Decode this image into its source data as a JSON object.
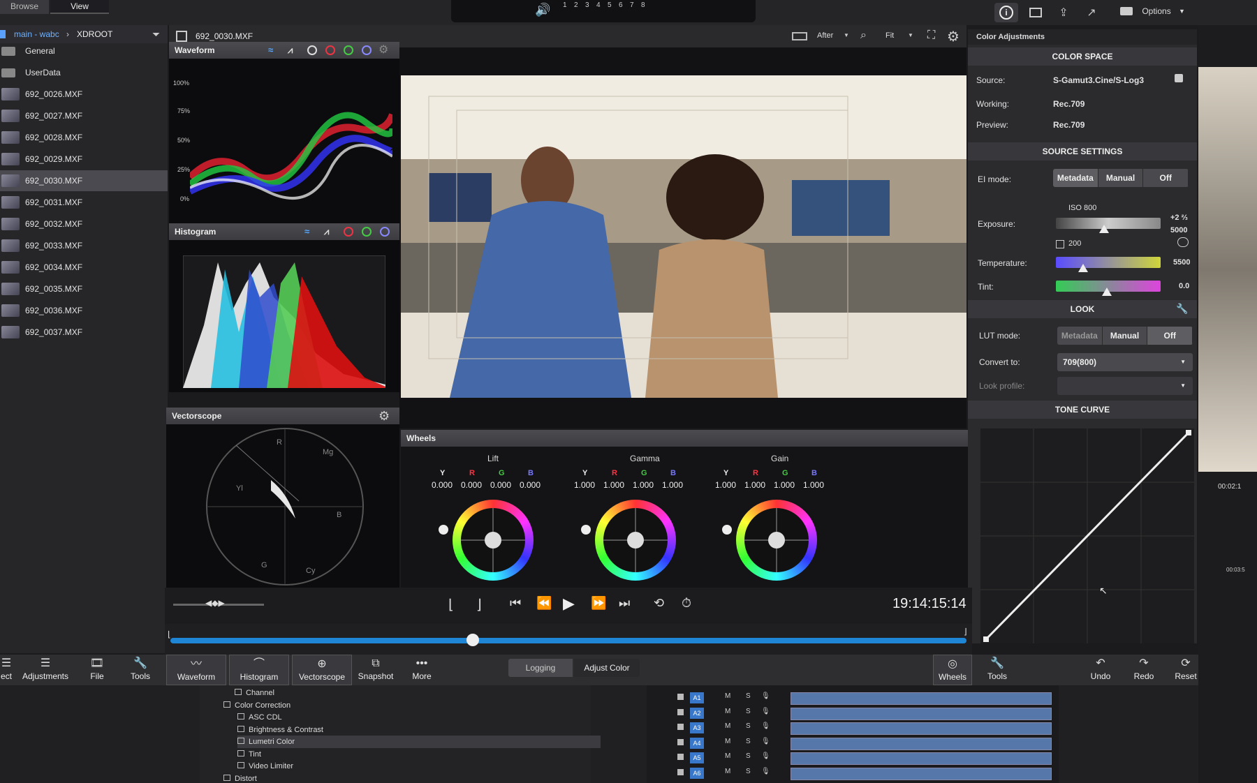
{
  "top": {
    "tabs": [
      "Browse",
      "View"
    ],
    "channels": [
      "1",
      "2",
      "3",
      "4",
      "5",
      "6",
      "7",
      "8"
    ],
    "options_label": "Options"
  },
  "browser": {
    "path": [
      "main - wabc",
      "XDROOT"
    ],
    "folders": [
      "General",
      "UserData"
    ],
    "files": [
      "692_0026.MXF",
      "692_0027.MXF",
      "692_0028.MXF",
      "692_0029.MXF",
      "692_0030.MXF",
      "692_0031.MXF",
      "692_0032.MXF",
      "692_0033.MXF",
      "692_0034.MXF",
      "692_0035.MXF",
      "692_0036.MXF",
      "692_0037.MXF"
    ],
    "selected": "692_0030.MXF"
  },
  "viewer": {
    "clip_name": "692_0030.MXF",
    "compare_mode": "After",
    "zoom": "Fit",
    "timecode": "19:14:15:14",
    "playhead_fraction": 0.38
  },
  "scopes": {
    "waveform_title": "Waveform",
    "waveform_ticks": [
      "100%",
      "75%",
      "50%",
      "25%",
      "0%"
    ],
    "histogram_title": "Histogram",
    "vectorscope_title": "Vectorscope",
    "vectorscope_labels": [
      "R",
      "Mg",
      "Yl",
      "B",
      "G",
      "Cy"
    ]
  },
  "wheels": {
    "title": "Wheels",
    "groups": [
      {
        "name": "Lift",
        "Y": "0.000",
        "R": "0.000",
        "G": "0.000",
        "B": "0.000"
      },
      {
        "name": "Gamma",
        "Y": "1.000",
        "R": "1.000",
        "G": "1.000",
        "B": "1.000"
      },
      {
        "name": "Gain",
        "Y": "1.000",
        "R": "1.000",
        "G": "1.000",
        "B": "1.000"
      }
    ],
    "channel_letters": [
      "Y",
      "R",
      "G",
      "B"
    ]
  },
  "color_adjustments": {
    "title": "Color Adjustments",
    "color_space": {
      "heading": "COLOR SPACE",
      "source_label": "Source:",
      "source": "S-Gamut3.Cine/S-Log3",
      "working_label": "Working:",
      "working": "Rec.709",
      "preview_label": "Preview:",
      "preview": "Rec.709"
    },
    "source_settings": {
      "heading": "SOURCE SETTINGS",
      "ei_label": "EI mode:",
      "ei_options": [
        "Metadata",
        "Manual",
        "Off"
      ],
      "iso": "ISO 800",
      "exposure_label": "Exposure:",
      "exposure_value": "+2 ⅔",
      "exposure_sub": "5000",
      "exposure_min": "200",
      "temperature_label": "Temperature:",
      "temperature_value": "5500",
      "tint_label": "Tint:",
      "tint_value": "0.0"
    },
    "look": {
      "heading": "LOOK",
      "lut_label": "LUT mode:",
      "lut_options": [
        "Metadata",
        "Manual",
        "Off"
      ],
      "convert_label": "Convert to:",
      "convert_value": "709(800)",
      "profile_label": "Look profile:"
    },
    "tone_curve": {
      "heading": "TONE CURVE"
    }
  },
  "toolbar": {
    "left": [
      "Adjustments",
      "File",
      "Tools"
    ],
    "scopes": [
      "Waveform",
      "Histogram",
      "Vectorscope",
      "Snapshot",
      "More"
    ],
    "modes": [
      "Logging",
      "Adjust Color"
    ],
    "right": [
      "Wheels",
      "Tools",
      "Undo",
      "Redo",
      "Reset"
    ],
    "cut_label": "ect"
  },
  "effects": {
    "items": [
      "Channel",
      "Color Correction",
      "ASC CDL",
      "Brightness & Contrast",
      "Lumetri Color",
      "Tint",
      "Video Limiter",
      "Distort"
    ]
  },
  "tracks": [
    "A1",
    "A2",
    "A3",
    "A4",
    "A5",
    "A6"
  ],
  "right_edge": {
    "timecode_a": "00:02:1",
    "timecode_b": "00:03:5"
  }
}
